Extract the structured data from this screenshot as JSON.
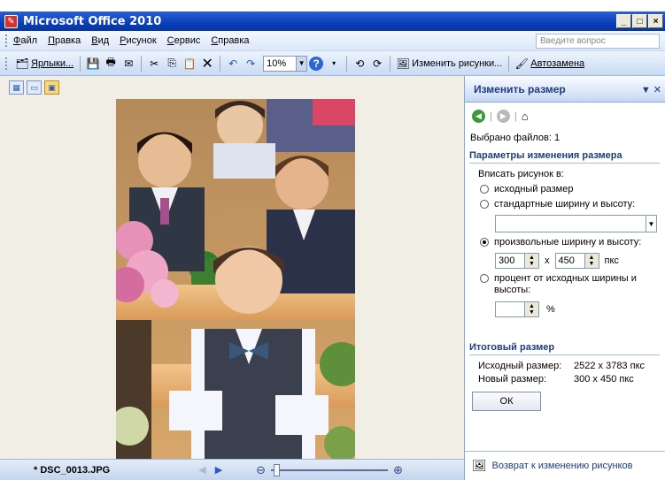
{
  "window": {
    "title": "Microsoft Office 2010",
    "controls": [
      "_",
      "□",
      "×"
    ]
  },
  "menu": {
    "items": [
      "Файл",
      "Правка",
      "Вид",
      "Рисунок",
      "Сервис",
      "Справка"
    ],
    "question_placeholder": "Введите вопрос"
  },
  "toolbar": {
    "shortcuts_label": "Ярлыки...",
    "zoom_value": "10%",
    "edit_pictures_label": "Изменить рисунки...",
    "autocorrect_label": "Автозамена"
  },
  "statusbar": {
    "file_name": "* DSC_0013.JPG",
    "zoom_level": 0.02
  },
  "pane": {
    "title": "Изменить размер",
    "selected_files": "Выбрано файлов: 1",
    "resize_section": "Параметры изменения размера",
    "fit_label": "Вписать рисунок в:",
    "options": [
      {
        "label": "исходный размер",
        "selected": false
      },
      {
        "label": "стандартные ширину и высоту:",
        "selected": false
      },
      {
        "label": "произвольные ширину и высоту:",
        "selected": true
      },
      {
        "label": "процент от исходных ширины и высоты:",
        "selected": false
      }
    ],
    "custom_width": "300",
    "custom_height": "450",
    "times_sign": "x",
    "units": "пкс",
    "percent_value": "",
    "percent_sign": "%",
    "result_section": "Итоговый размер",
    "original_size_label": "Исходный размер:",
    "original_size_value": "2522 x 3783 пкс",
    "new_size_label": "Новый размер:",
    "new_size_value": "300 x 450 пкс",
    "ok_label": "ОК",
    "back_link": "Возврат к изменению рисунков"
  }
}
